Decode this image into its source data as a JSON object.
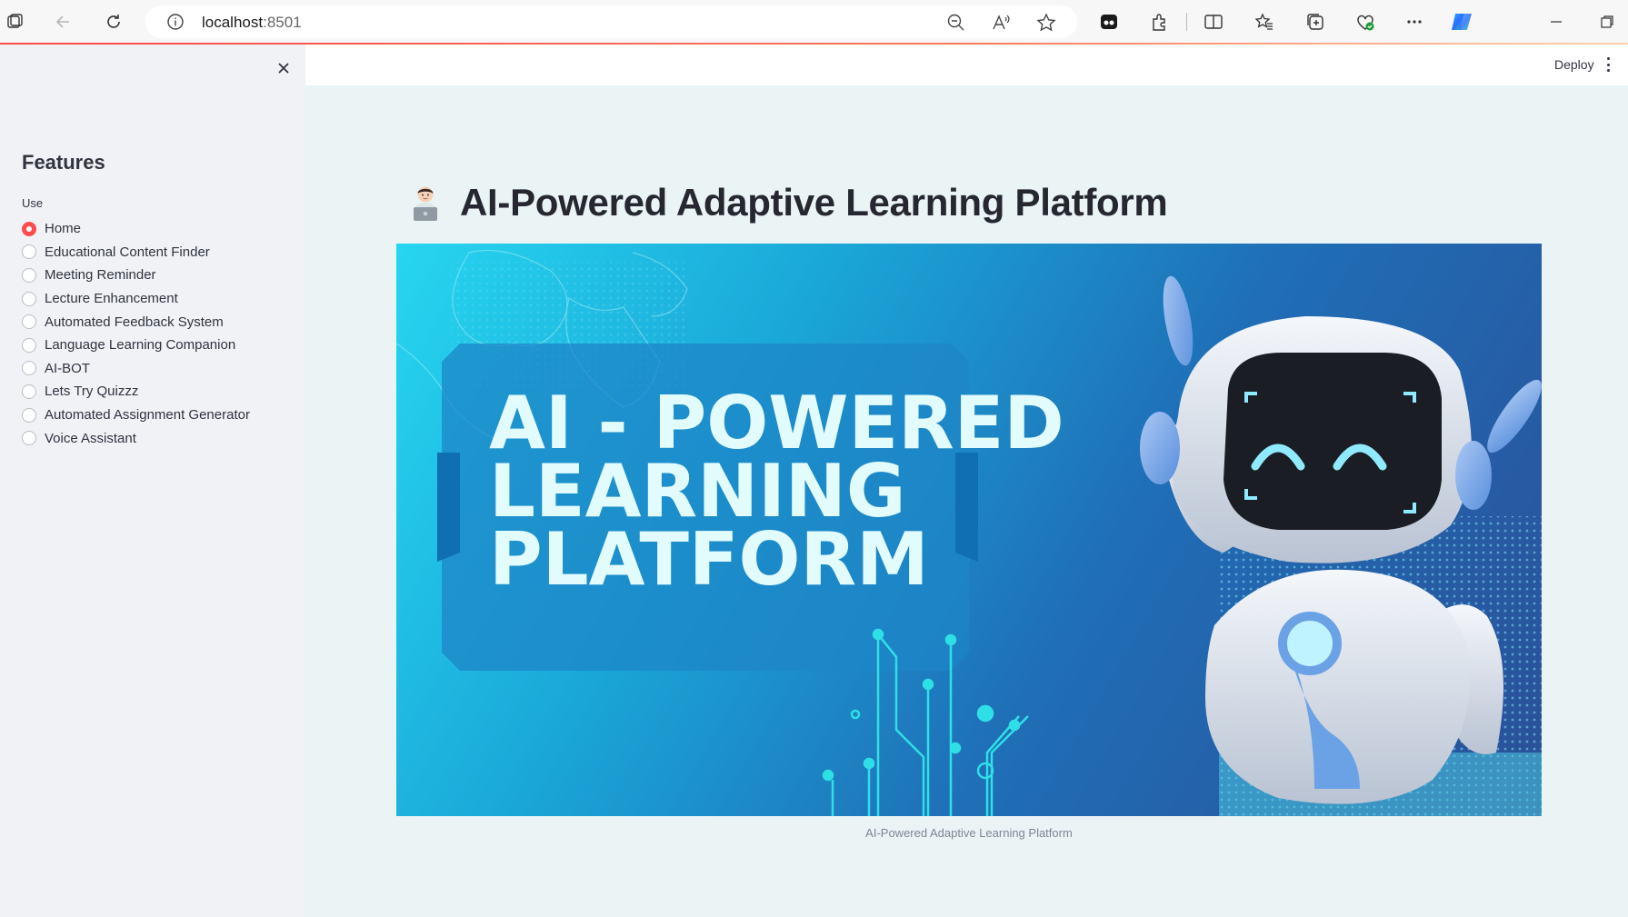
{
  "browser": {
    "url_host": "localhost",
    "url_port": ":8501"
  },
  "sidebar": {
    "title": "Features",
    "radio_label": "Use",
    "items": [
      {
        "label": "Home",
        "selected": true
      },
      {
        "label": "Educational Content Finder",
        "selected": false
      },
      {
        "label": "Meeting Reminder",
        "selected": false
      },
      {
        "label": "Lecture Enhancement",
        "selected": false
      },
      {
        "label": "Automated Feedback System",
        "selected": false
      },
      {
        "label": "Language Learning Companion",
        "selected": false
      },
      {
        "label": "AI-BOT",
        "selected": false
      },
      {
        "label": "Lets Try Quizzz",
        "selected": false
      },
      {
        "label": "Automated Assignment Generator",
        "selected": false
      },
      {
        "label": "Voice Assistant",
        "selected": false
      }
    ]
  },
  "header": {
    "deploy_label": "Deploy"
  },
  "main": {
    "title": "AI-Powered Adaptive Learning Platform",
    "hero": {
      "line1": "AI - POWERED",
      "line2": "LEARNING",
      "line3": "PLATFORM",
      "caption": "AI-Powered Adaptive Learning Platform"
    }
  },
  "colors": {
    "accent": "#ff4b4b",
    "sidebar_bg": "#f0f2f6",
    "main_bg": "#eaf4f4"
  }
}
